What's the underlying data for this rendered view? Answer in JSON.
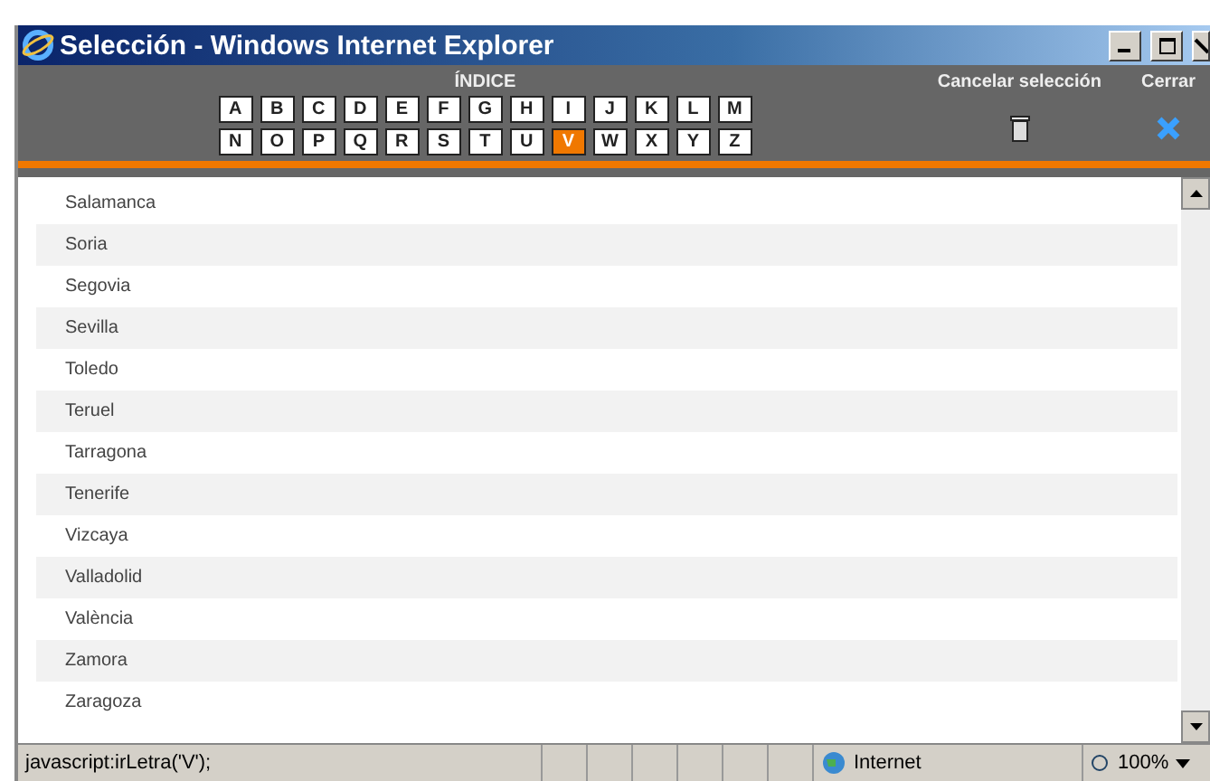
{
  "window": {
    "title": "Selección - Windows Internet Explorer"
  },
  "index": {
    "title": "ÍNDICE",
    "letters": [
      {
        "label": "A",
        "selected": false
      },
      {
        "label": "B",
        "selected": false
      },
      {
        "label": "C",
        "selected": false
      },
      {
        "label": "D",
        "selected": false
      },
      {
        "label": "E",
        "selected": false
      },
      {
        "label": "F",
        "selected": false
      },
      {
        "label": "G",
        "selected": false
      },
      {
        "label": "H",
        "selected": false
      },
      {
        "label": "I",
        "selected": false
      },
      {
        "label": "J",
        "selected": false
      },
      {
        "label": "K",
        "selected": false
      },
      {
        "label": "L",
        "selected": false
      },
      {
        "label": "M",
        "selected": false
      },
      {
        "label": "N",
        "selected": false
      },
      {
        "label": "O",
        "selected": false
      },
      {
        "label": "P",
        "selected": false
      },
      {
        "label": "Q",
        "selected": false
      },
      {
        "label": "R",
        "selected": false
      },
      {
        "label": "S",
        "selected": false
      },
      {
        "label": "T",
        "selected": false
      },
      {
        "label": "U",
        "selected": false
      },
      {
        "label": "V",
        "selected": true
      },
      {
        "label": "W",
        "selected": false
      },
      {
        "label": "X",
        "selected": false
      },
      {
        "label": "Y",
        "selected": false
      },
      {
        "label": "Z",
        "selected": false
      }
    ]
  },
  "actions": [
    {
      "label": "Cancelar selección",
      "kind": "trash"
    },
    {
      "label": "Cerrar",
      "kind": "close"
    }
  ],
  "items": [
    "Salamanca",
    "Soria",
    "Segovia",
    "Sevilla",
    "Toledo",
    "Teruel",
    "Tarragona",
    "Tenerife",
    "Vizcaya",
    "Valladolid",
    "València",
    "Zamora",
    "Zaragoza"
  ],
  "status_bar": {
    "text": "javascript:irLetra('V');",
    "zone": "Internet",
    "zoom": "100%"
  }
}
